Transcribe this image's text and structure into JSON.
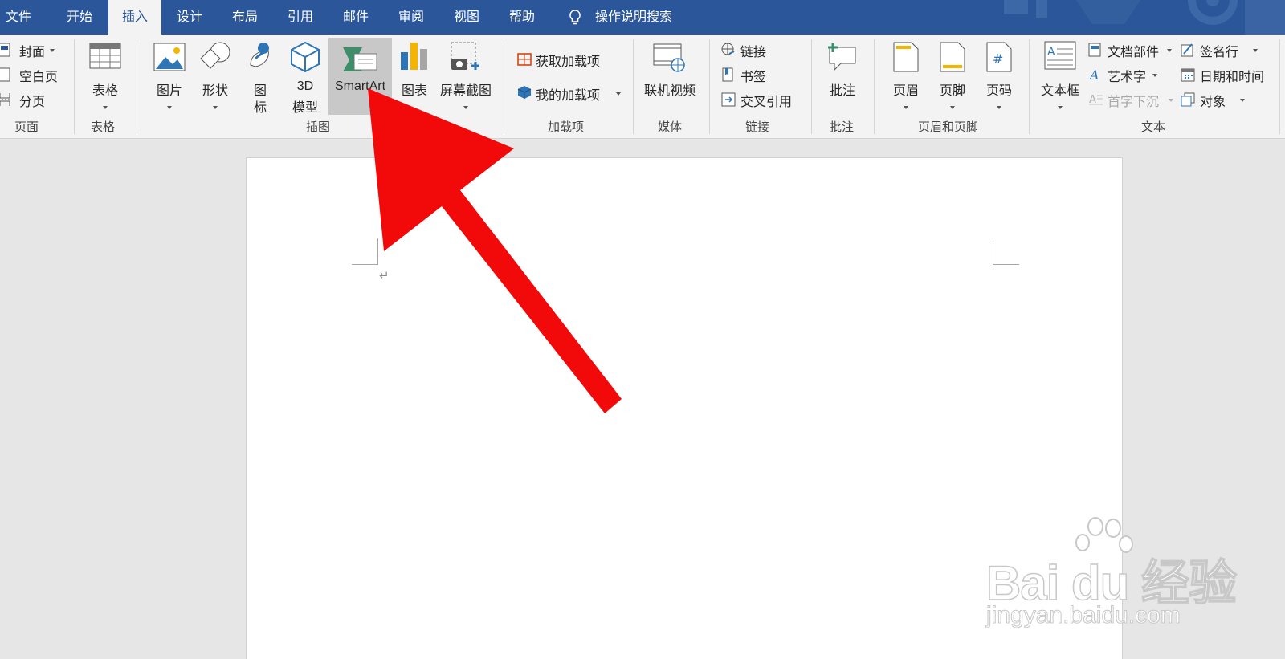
{
  "tabs": [
    "文件",
    "开始",
    "插入",
    "设计",
    "布局",
    "引用",
    "邮件",
    "审阅",
    "视图",
    "帮助"
  ],
  "active_tab": "插入",
  "tell_me": "操作说明搜索",
  "groups": {
    "pages": {
      "label": "页面",
      "items": [
        "封面",
        "空白页",
        "分页"
      ]
    },
    "tables": {
      "label": "表格",
      "table": "表格"
    },
    "illustrations": {
      "label": "插图",
      "picture": "图片",
      "shapes": "形状",
      "icons_1": "图",
      "icons_2": "标",
      "model_1": "3D",
      "model_2": "模型",
      "smartart": "SmartArt",
      "chart": "图表",
      "screenshot": "屏幕截图"
    },
    "addins": {
      "label": "加载项",
      "get": "获取加载项",
      "my": "我的加载项"
    },
    "media": {
      "label": "媒体",
      "video": "联机视频"
    },
    "links": {
      "label": "链接",
      "link": "链接",
      "bookmark": "书签",
      "crossref": "交叉引用"
    },
    "comments": {
      "label": "批注",
      "comment": "批注"
    },
    "header_footer": {
      "label": "页眉和页脚",
      "header": "页眉",
      "footer": "页脚",
      "page_number": "页码"
    },
    "text": {
      "label": "文本",
      "textbox": "文本框",
      "quick_parts": "文档部件",
      "wordart": "艺术字",
      "dropcap": "首字下沉",
      "signature": "签名行",
      "datetime": "日期和时间",
      "object": "对象"
    }
  },
  "document": {
    "paragraph_mark": "↵"
  },
  "watermark": {
    "logo": "Bai du 经验",
    "url": "jingyan.baidu.com"
  },
  "colors": {
    "accent": "#2b579a",
    "arrow": "#f20a0a",
    "ribbon": "#f3f3f3"
  }
}
